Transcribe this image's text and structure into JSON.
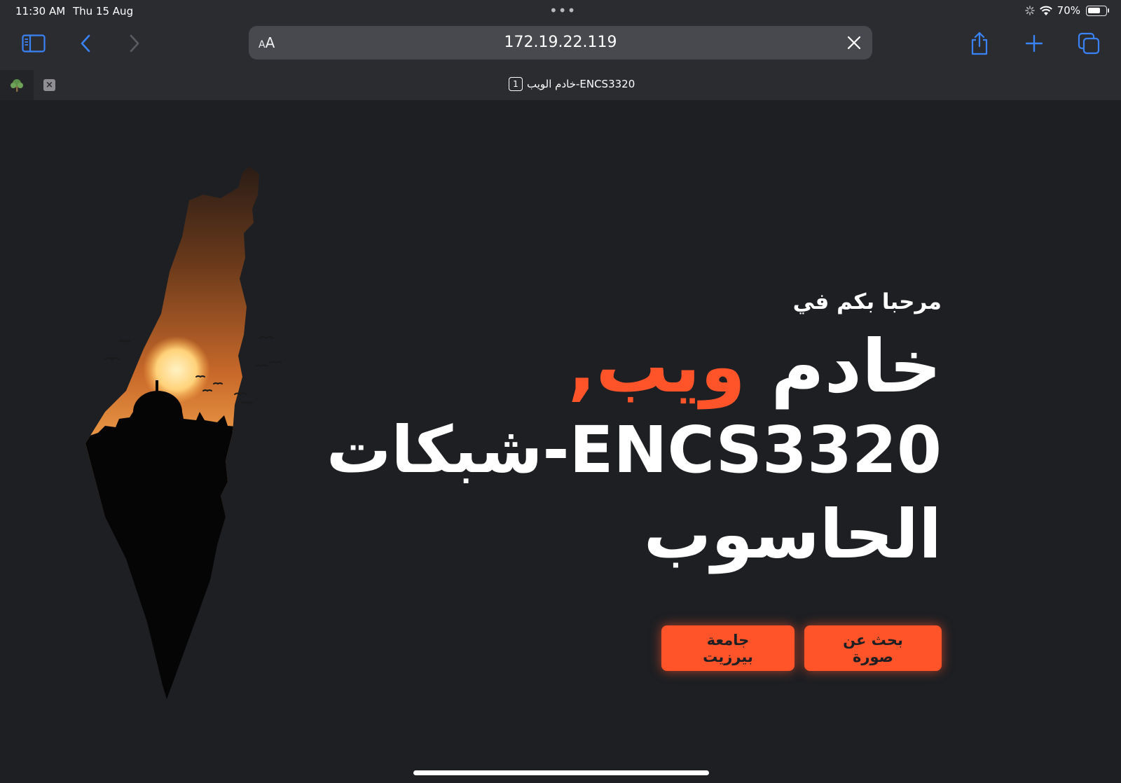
{
  "status": {
    "time": "11:30 AM",
    "date": "Thu 15 Aug",
    "battery": "70%"
  },
  "browser": {
    "url": "172.19.22.119",
    "aa_label": "AA",
    "tab_title": "خادم الويب-ENCS3320",
    "tab_count": "1"
  },
  "hero": {
    "welcome": "مرحبا بكم في",
    "title_word1": "خادم",
    "title_accent": "ويب,",
    "title_line2": "ENCS3320-شبكات",
    "title_line3": "الحاسوب"
  },
  "buttons": {
    "search_image": "بحث عن صورة",
    "birzeit": "جامعة بيرزيت"
  },
  "colors": {
    "background": "#1d1f23",
    "accent": "#ff5329",
    "chrome": "#2b2c30",
    "icon_blue": "#3a82f7"
  },
  "icons": [
    "sidebar-icon",
    "back-icon",
    "forward-icon",
    "close-icon",
    "share-icon",
    "plus-icon",
    "tabs-icon",
    "wifi-icon",
    "tree-favicon-icon"
  ]
}
